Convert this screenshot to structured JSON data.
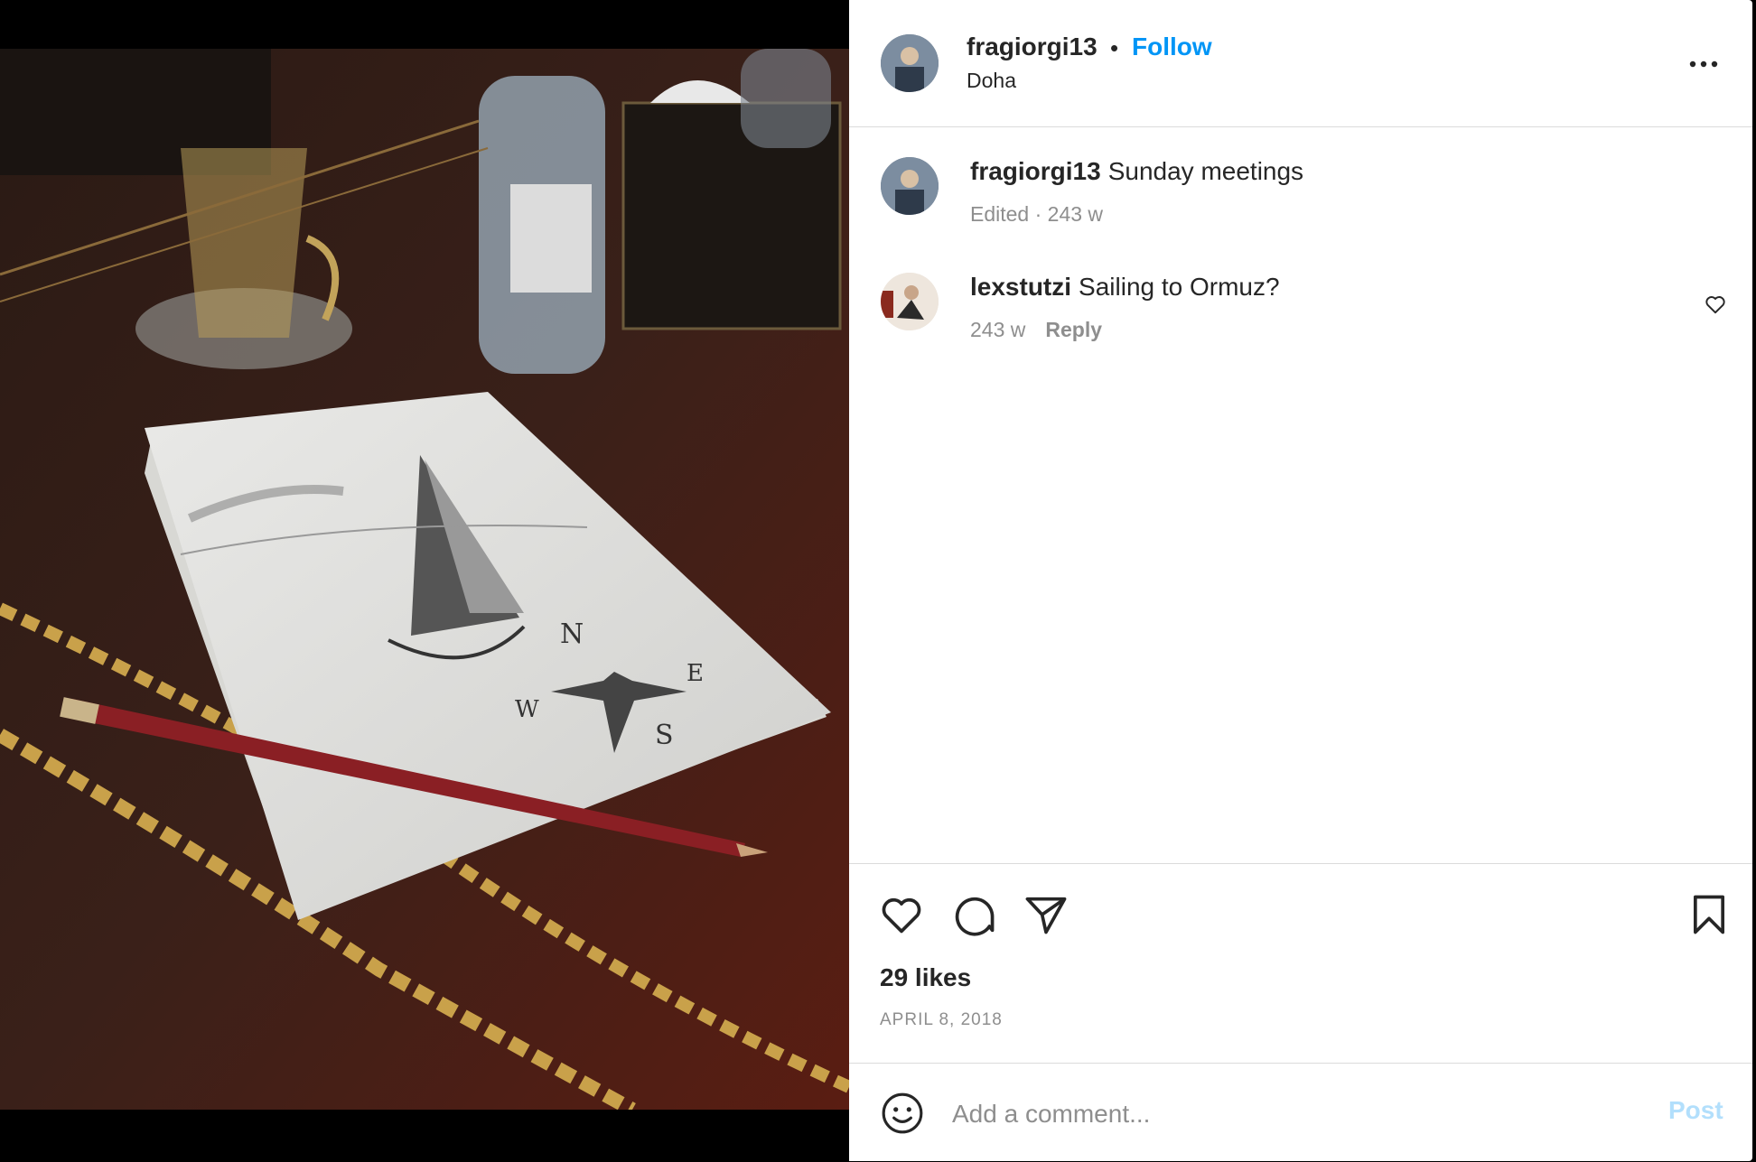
{
  "post": {
    "author": "fragiorgi13",
    "follow_label": "Follow",
    "separator": "•",
    "location": "Doha"
  },
  "caption": {
    "username": "fragiorgi13",
    "text": "Sunday meetings",
    "meta": "Edited · 243 w"
  },
  "comments": [
    {
      "username": "lexstutzi",
      "text": "Sailing to Ormuz?",
      "time": "243 w",
      "reply_label": "Reply"
    }
  ],
  "likes": "29 likes",
  "date": "APRIL 8, 2018",
  "comment_box": {
    "placeholder": "Add a comment...",
    "post_label": "Post"
  },
  "colors": {
    "accent": "#0095f6",
    "post_disabled": "#b2dffc",
    "muted": "#8e8e8e",
    "text": "#262626"
  },
  "icons": [
    "more-options-icon",
    "heart-icon",
    "comment-icon",
    "share-icon",
    "bookmark-icon",
    "emoji-icon"
  ]
}
